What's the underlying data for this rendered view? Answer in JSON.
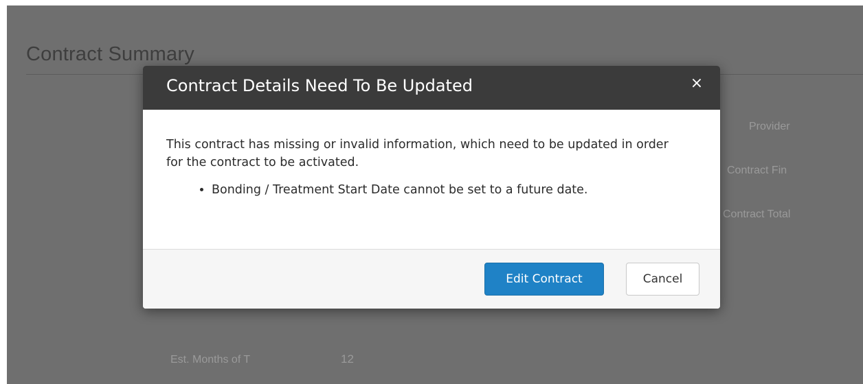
{
  "background": {
    "section_title": "Contract Summary",
    "right_labels": [
      "Provider",
      "Contract Fin",
      "Contract Total"
    ],
    "bottom_label": "Est. Months of T",
    "bottom_value": "12"
  },
  "modal": {
    "title": "Contract Details Need To Be Updated",
    "close_icon": "×",
    "message": "This contract has missing or invalid information, which need to be updated in order for the contract to be activated.",
    "issues": [
      "Bonding / Treatment Start Date cannot be set to a future date."
    ],
    "buttons": {
      "primary": "Edit Contract",
      "secondary": "Cancel"
    }
  },
  "colors": {
    "header_bg": "#3b3b3b",
    "primary_button": "#1f82c6",
    "backdrop": "#6f6f6f"
  }
}
